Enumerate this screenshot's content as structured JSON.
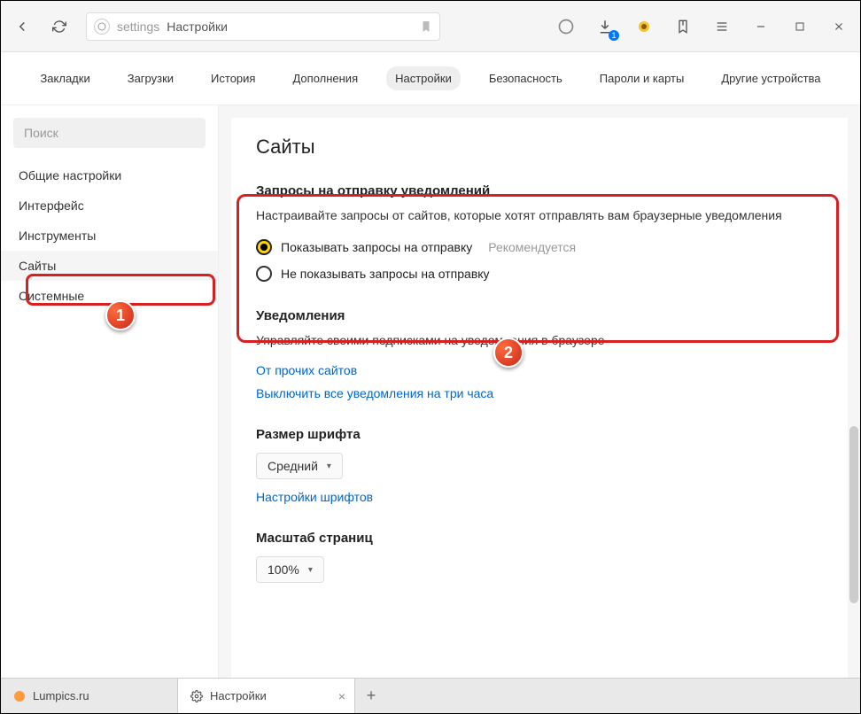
{
  "urlbar": {
    "prefix": "settings",
    "title": "Настройки"
  },
  "topnav": {
    "items": [
      "Закладки",
      "Загрузки",
      "История",
      "Дополнения",
      "Настройки",
      "Безопасность",
      "Пароли и карты",
      "Другие устройства"
    ],
    "active_index": 4
  },
  "sidebar": {
    "search_placeholder": "Поиск",
    "items": [
      "Общие настройки",
      "Интерфейс",
      "Инструменты",
      "Сайты",
      "Системные"
    ],
    "active_index": 3
  },
  "content": {
    "title": "Сайты",
    "notifications_request": {
      "heading": "Запросы на отправку уведомлений",
      "desc": "Настраивайте запросы от сайтов, которые хотят отправлять вам браузерные уведомления",
      "option_show": "Показывать запросы на отправку",
      "option_show_hint": "Рекомендуется",
      "option_hide": "Не показывать запросы на отправку"
    },
    "notifications": {
      "heading": "Уведомления",
      "desc": "Управляйте своими подписками на уведомления в браузере",
      "link_other": "От прочих сайтов",
      "link_mute": "Выключить все уведомления на три часа"
    },
    "font": {
      "heading": "Размер шрифта",
      "value": "Средний",
      "link": "Настройки шрифтов"
    },
    "zoom": {
      "heading": "Масштаб страниц",
      "value": "100%"
    }
  },
  "tabs": {
    "tab1": "Lumpics.ru",
    "tab2": "Настройки"
  },
  "markers": {
    "m1": "1",
    "m2": "2"
  }
}
